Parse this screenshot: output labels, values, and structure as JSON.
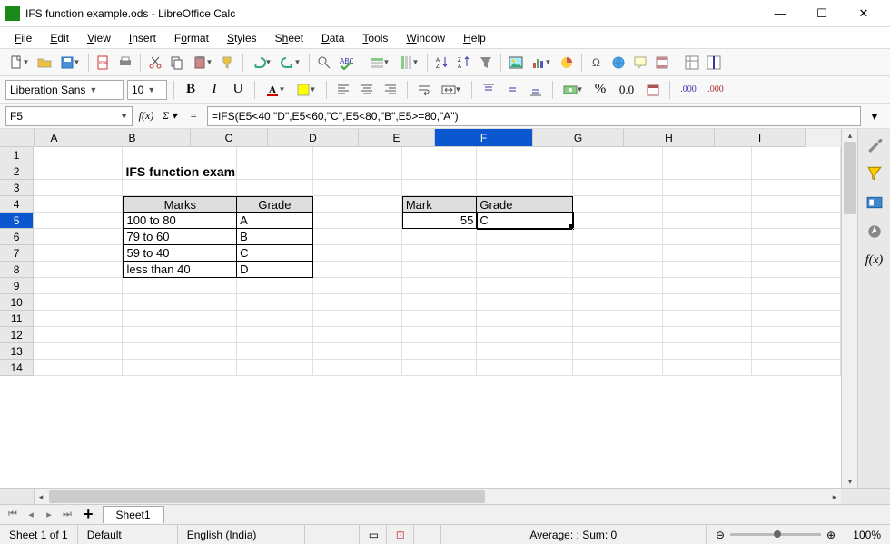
{
  "window": {
    "title": "IFS function example.ods - LibreOffice Calc"
  },
  "menu": {
    "file": "File",
    "edit": "Edit",
    "view": "View",
    "insert": "Insert",
    "format": "Format",
    "styles": "Styles",
    "sheet": "Sheet",
    "data": "Data",
    "tools": "Tools",
    "window": "Window",
    "help": "Help"
  },
  "format": {
    "font": "Liberation Sans",
    "size": "10",
    "pct_label": "%",
    "num_label": "0.0",
    "add000": ".000",
    "del000": ".000"
  },
  "namebox": "F5",
  "formula": "=IFS(E5<40,\"D\",E5<60,\"C\",E5<80,\"B\",E5>=80,\"A\")",
  "cols": [
    "A",
    "B",
    "C",
    "D",
    "E",
    "F",
    "G",
    "H",
    "I"
  ],
  "rows": [
    1,
    2,
    3,
    4,
    5,
    6,
    7,
    8,
    9,
    10,
    11,
    12,
    13,
    14
  ],
  "title_cell": "IFS function example",
  "table1": {
    "h1": "Marks",
    "h2": "Grade",
    "r": [
      [
        "100 to 80",
        "A"
      ],
      [
        "79 to 60",
        "B"
      ],
      [
        "59 to 40",
        "C"
      ],
      [
        "less than 40",
        "D"
      ]
    ]
  },
  "table2": {
    "h1": "Mark",
    "h2": "Grade",
    "v1": "55",
    "v2": "C"
  },
  "tab": "Sheet1",
  "status": {
    "sheet": "Sheet 1 of 1",
    "style": "Default",
    "lang": "English (India)",
    "sum": "Average: ; Sum: 0",
    "zoom": "100%"
  },
  "sidebar": {
    "fx": "f(x)"
  },
  "icons": {
    "bold": "B",
    "italic": "I",
    "underline": "U"
  }
}
